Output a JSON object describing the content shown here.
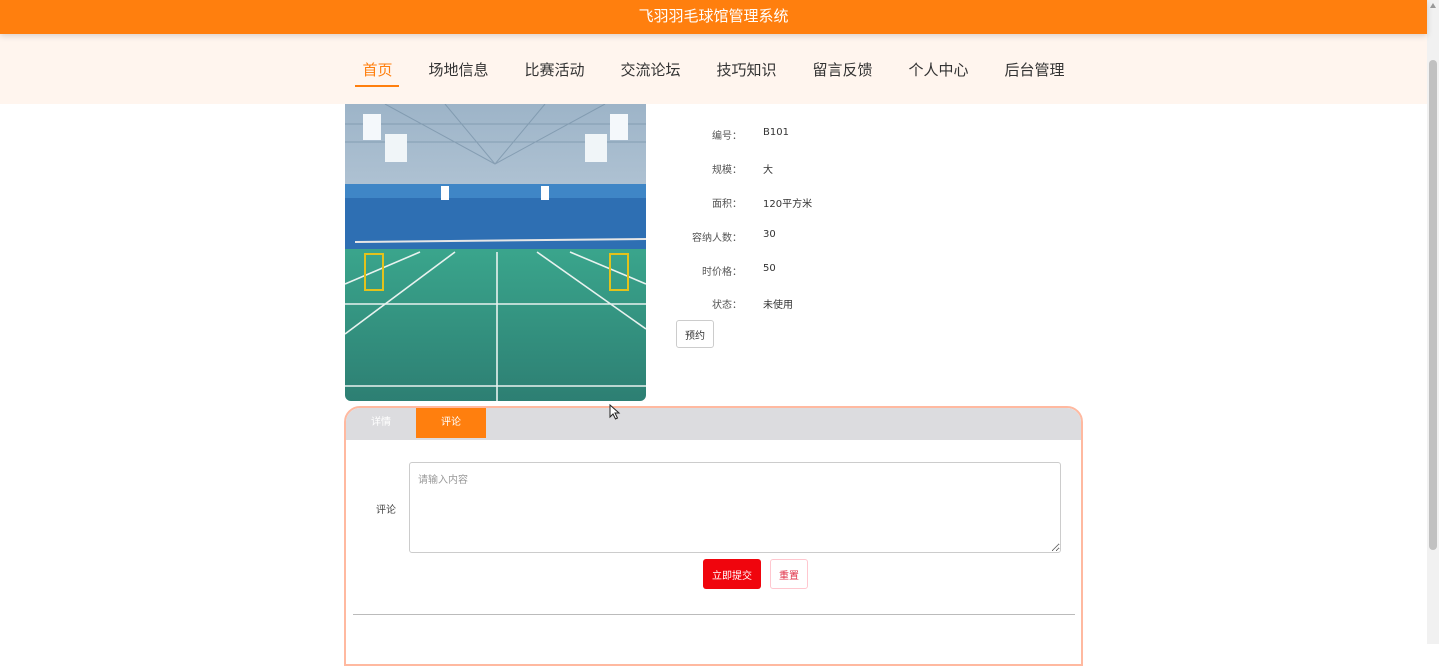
{
  "app": {
    "title": "飞羽羽毛球馆管理系统"
  },
  "nav": {
    "items": [
      {
        "label": "首页",
        "active": true
      },
      {
        "label": "场地信息"
      },
      {
        "label": "比赛活动"
      },
      {
        "label": "交流论坛"
      },
      {
        "label": "技巧知识"
      },
      {
        "label": "留言反馈"
      },
      {
        "label": "个人中心"
      },
      {
        "label": "后台管理"
      }
    ]
  },
  "court": {
    "info": [
      {
        "label": "编号：",
        "value": "B101"
      },
      {
        "label": "规模：",
        "value": "大"
      },
      {
        "label": "面积：",
        "value": "120平方米"
      },
      {
        "label": "容纳人数：",
        "value": "30"
      },
      {
        "label": "时价格：",
        "value": "50"
      },
      {
        "label": "状态：",
        "value": "未使用"
      }
    ],
    "book_label": "预约"
  },
  "tabs": [
    {
      "label": "详情"
    },
    {
      "label": "评论",
      "active": true
    }
  ],
  "comment": {
    "label": "评论",
    "placeholder": "请输入内容",
    "submit_label": "立即提交",
    "reset_label": "重置"
  },
  "colors": {
    "accent": "#ff7f0e",
    "nav_bg": "#fff5ee",
    "submit": "#f0050d",
    "panel_border": "#ffb9a0"
  }
}
